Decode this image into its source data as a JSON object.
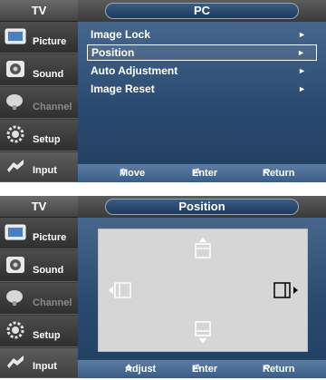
{
  "sidebar": {
    "header": "TV",
    "items": [
      {
        "label": "Picture",
        "icon": "picture-icon",
        "state": "normal"
      },
      {
        "label": "Sound",
        "icon": "sound-icon",
        "state": "normal"
      },
      {
        "label": "Channel",
        "icon": "channel-icon",
        "state": "disabled"
      },
      {
        "label": "Setup",
        "icon": "setup-icon",
        "state": "normal"
      },
      {
        "label": "Input",
        "icon": "input-icon",
        "state": "active"
      }
    ]
  },
  "pc_menu": {
    "title": "PC",
    "items": [
      {
        "label": "Image Lock",
        "arrow": "►",
        "selected": false
      },
      {
        "label": "Position",
        "arrow": "►",
        "selected": true
      },
      {
        "label": "Auto Adjustment",
        "arrow": "►",
        "selected": false
      },
      {
        "label": "Image Reset",
        "arrow": "►",
        "selected": false
      }
    ],
    "footer": {
      "move": {
        "icon": "⇕",
        "label": "Move"
      },
      "enter": {
        "icon": "⏎",
        "label": "Enter"
      },
      "return": {
        "icon": "↶",
        "label": "Return"
      }
    }
  },
  "position_panel": {
    "title": "Position",
    "footer": {
      "adjust": {
        "icon": "✥",
        "label": "Adjust"
      },
      "enter": {
        "icon": "⏎",
        "label": "Enter"
      },
      "return": {
        "icon": "↶",
        "label": "Return"
      }
    }
  },
  "colors": {
    "sidebar_bg": "#3c3c3c",
    "panel_blue": "#2a496f",
    "footer_blue": "#3a5d85",
    "position_box": "#d6d6d6"
  }
}
